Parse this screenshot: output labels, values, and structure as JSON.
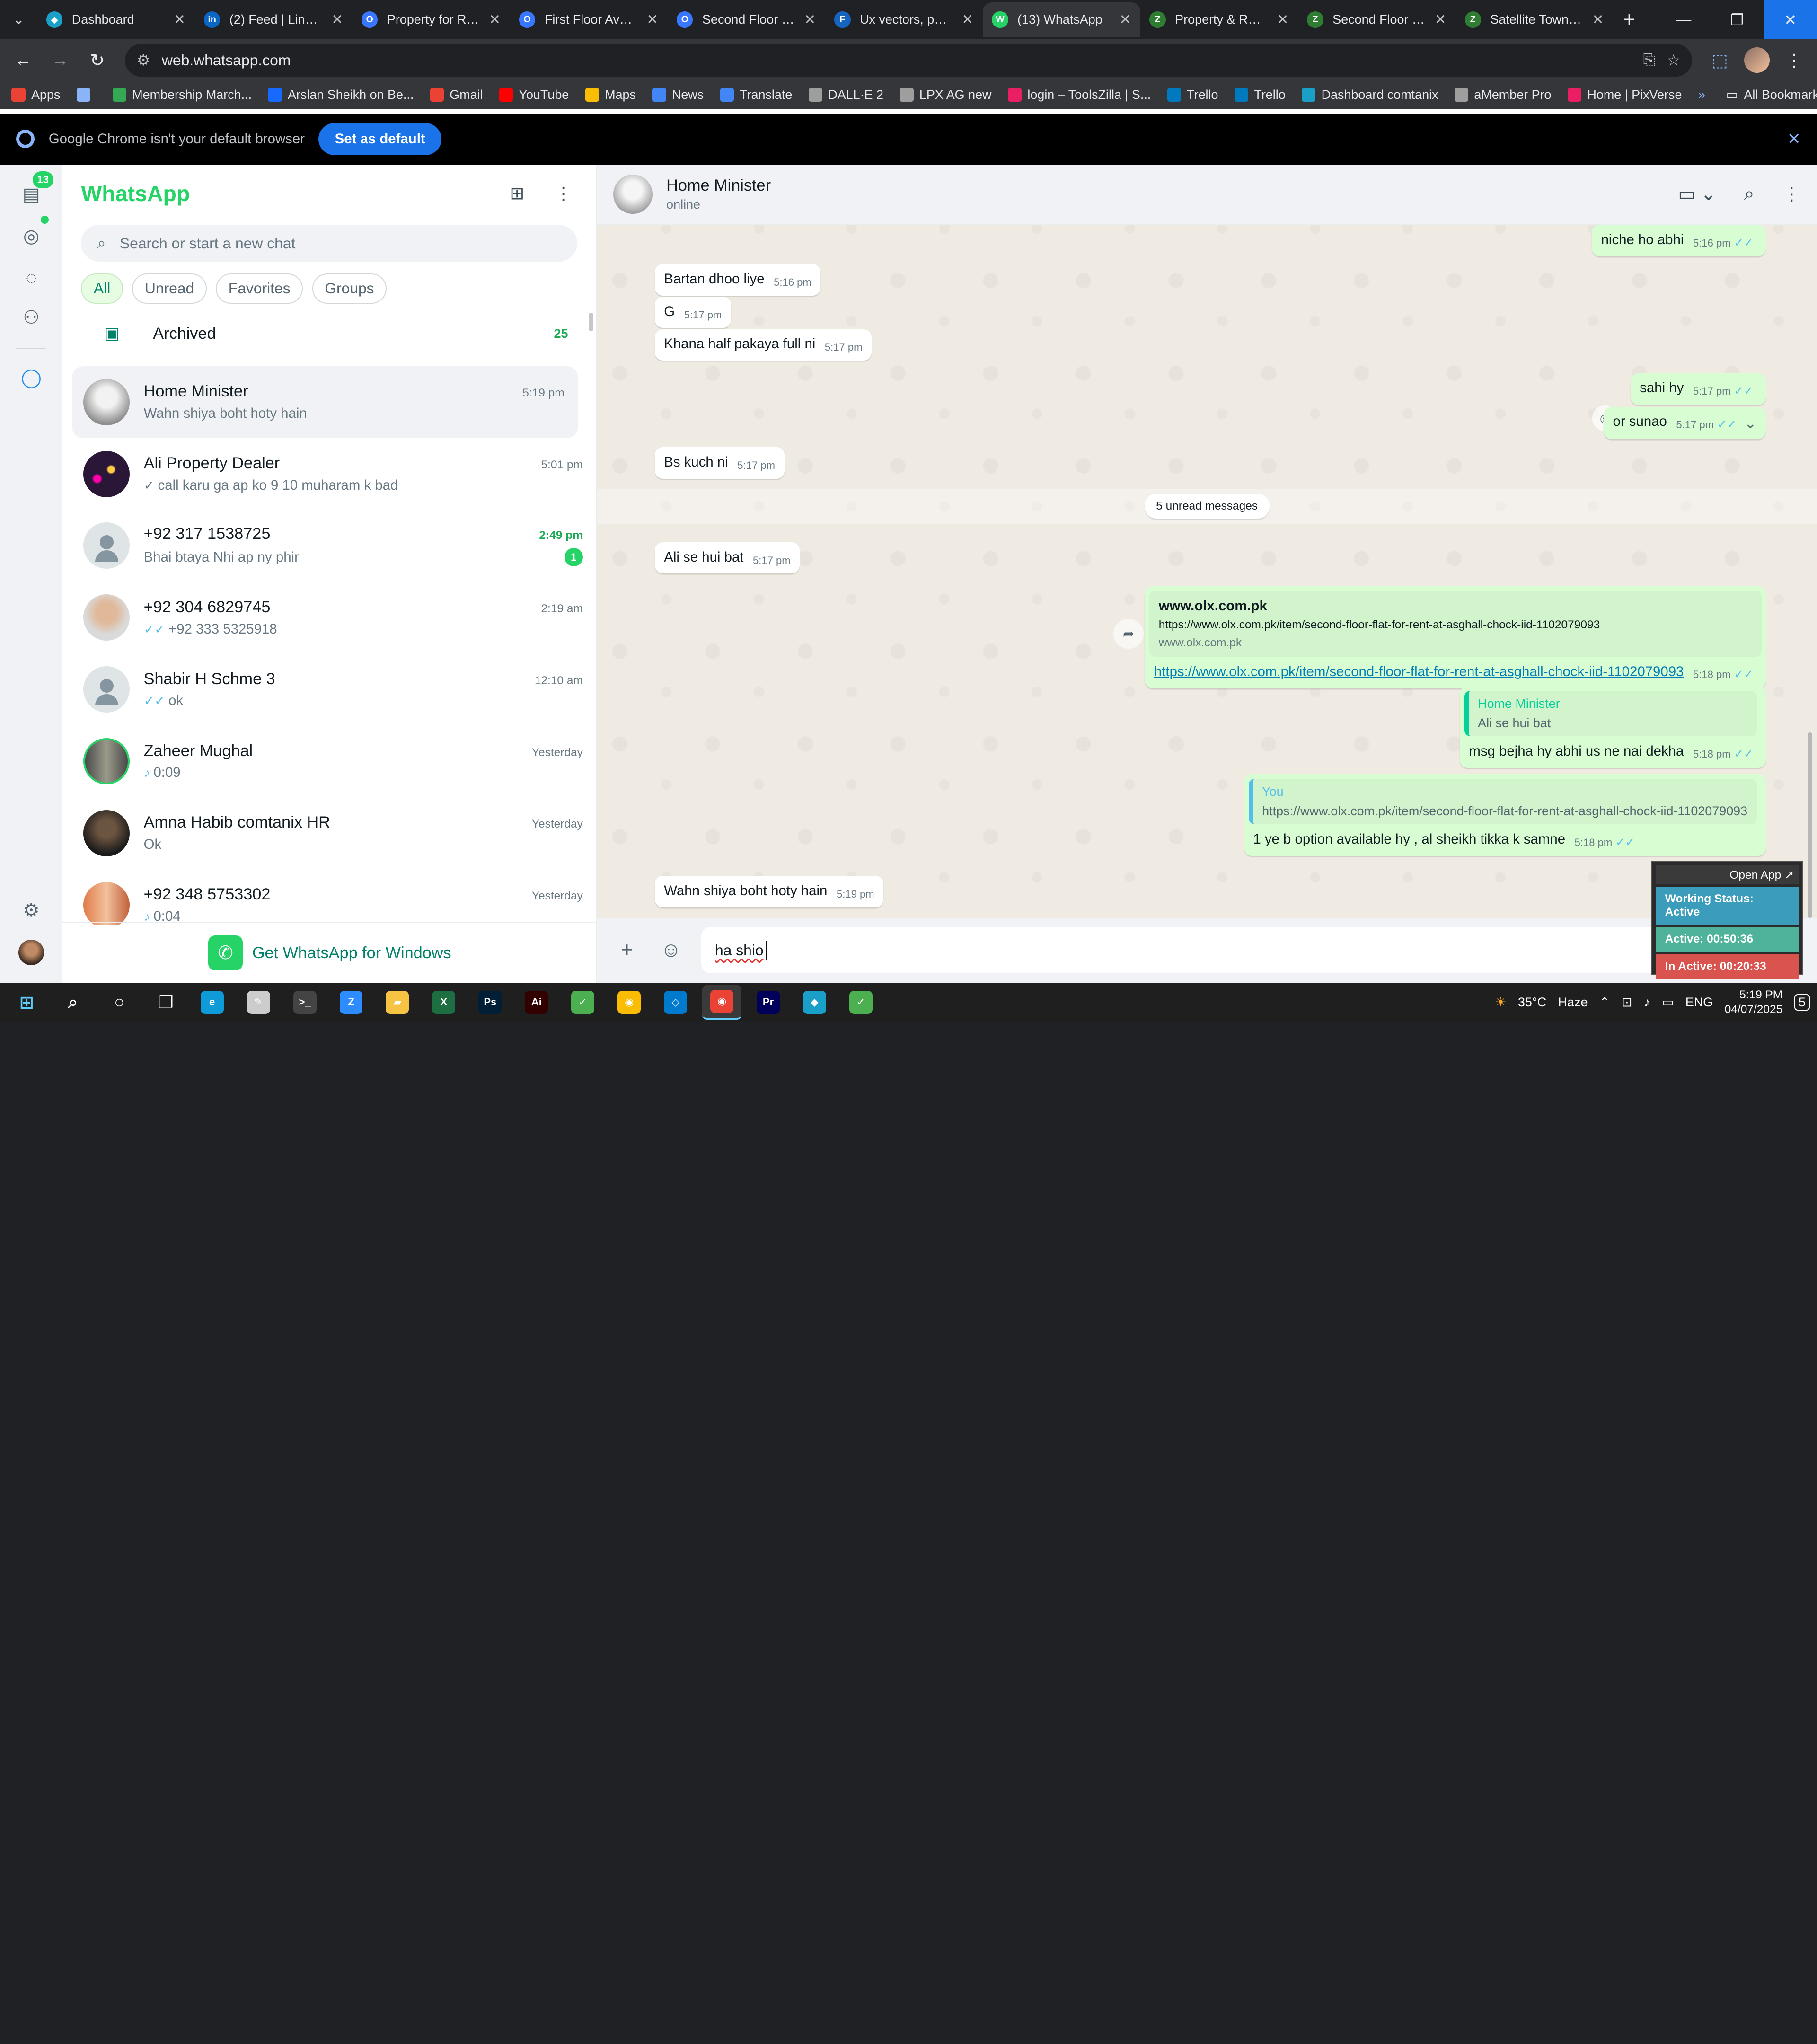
{
  "browser": {
    "tabs": [
      {
        "title": "Dashboard",
        "color": "#1aa0c8",
        "glyph": "◆"
      },
      {
        "title": "(2) Feed | LinkedIn",
        "color": "#0a66c2",
        "glyph": "in"
      },
      {
        "title": "Property for Rent",
        "color": "#3a77ff",
        "glyph": "O"
      },
      {
        "title": "First Floor Ava For",
        "color": "#3a77ff",
        "glyph": "O"
      },
      {
        "title": "Second Floor Flat",
        "color": "#3a77ff",
        "glyph": "O"
      },
      {
        "title": "Ux vectors, photos",
        "color": "#1565c0",
        "glyph": "F"
      },
      {
        "title": "(13) WhatsApp",
        "color": "#25d366",
        "glyph": "W"
      },
      {
        "title": "Property & Real E",
        "color": "#2e7d32",
        "glyph": "Z"
      },
      {
        "title": "Second Floor Flat",
        "color": "#2e7d32",
        "glyph": "Z"
      },
      {
        "title": "Satellite Town 5 M",
        "color": "#2e7d32",
        "glyph": "Z"
      }
    ],
    "active_tab_index": 6,
    "url": "web.whatsapp.com",
    "bookmarks": [
      {
        "label": "Apps",
        "color": "#ea4335"
      },
      {
        "label": "",
        "color": "#8ab4f8"
      },
      {
        "label": "Membership March...",
        "color": "#34a853"
      },
      {
        "label": "Arslan Sheikh on Be...",
        "color": "#1769ff"
      },
      {
        "label": "Gmail",
        "color": "#ea4335"
      },
      {
        "label": "YouTube",
        "color": "#ff0000"
      },
      {
        "label": "Maps",
        "color": "#fbbc04"
      },
      {
        "label": "News",
        "color": "#4285f4"
      },
      {
        "label": "Translate",
        "color": "#4285f4"
      },
      {
        "label": "DALL·E 2",
        "color": "#9e9e9e"
      },
      {
        "label": "LPX AG new",
        "color": "#9e9e9e"
      },
      {
        "label": "login – ToolsZilla | S...",
        "color": "#e91e63"
      },
      {
        "label": "Trello",
        "color": "#0079bf"
      },
      {
        "label": "Trello",
        "color": "#0079bf"
      },
      {
        "label": "Dashboard comtanix",
        "color": "#1aa0c8"
      },
      {
        "label": "aMember Pro",
        "color": "#9e9e9e"
      },
      {
        "label": "Home | PixVerse",
        "color": "#e91e63"
      }
    ],
    "all_bookmarks": "All Bookmarks",
    "infobar_text": "Google Chrome isn't your default browser",
    "infobar_button": "Set as default"
  },
  "rail": {
    "badge": "13"
  },
  "sidebar": {
    "title": "WhatsApp",
    "search_placeholder": "Search or start a new chat",
    "filters": [
      "All",
      "Unread",
      "Favorites",
      "Groups"
    ],
    "archived_label": "Archived",
    "archived_count": "25",
    "get_app": "Get WhatsApp for Windows",
    "chats": [
      {
        "name": "Home Minister",
        "time": "5:19 pm",
        "preview": "Wahn shiya boht hoty hain",
        "avatar": "photo-grey",
        "tick": "",
        "unread": "",
        "active": true
      },
      {
        "name": "Ali Property Dealer",
        "time": "5:01 pm",
        "preview": "call karu ga ap ko 9 10 muharam k bad",
        "avatar": "photo-candles",
        "tick": "grey",
        "unread": "",
        "active": false
      },
      {
        "name": "+92 317 1538725",
        "time": "2:49 pm",
        "preview": "Bhai btaya Nhi ap ny phir",
        "avatar": "default",
        "tick": "",
        "unread": "1",
        "active": false
      },
      {
        "name": "+92 304 6829745",
        "time": "2:19 am",
        "preview": "+92 333 5325918",
        "avatar": "photo-man",
        "tick": "blue",
        "unread": "",
        "active": false
      },
      {
        "name": "Shabir H  Schme 3",
        "time": "12:10 am",
        "preview": "ok",
        "avatar": "default",
        "tick": "blue",
        "unread": "",
        "active": false
      },
      {
        "name": "Zaheer Mughal",
        "time": "Yesterday",
        "preview": "0:09",
        "avatar": "photo-group",
        "tick": "mic",
        "unread": "",
        "active": false
      },
      {
        "name": "Amna Habib comtanix HR",
        "time": "Yesterday",
        "preview": "Ok",
        "avatar": "photo-dark",
        "tick": "",
        "unread": "",
        "active": false
      },
      {
        "name": "+92 348 5753302",
        "time": "Yesterday",
        "preview": "0:04",
        "avatar": "photo-couple",
        "tick": "mic",
        "unread": "",
        "active": false
      }
    ]
  },
  "conversation": {
    "name": "Home Minister",
    "status": "online",
    "unread_divider": "5 unread messages",
    "composer_text": "ha shio",
    "messages": [
      {
        "dir": "out",
        "text": "niche ho abhi",
        "time": "5:16 pm",
        "tick": "blue"
      },
      {
        "dir": "in",
        "text": "Bartan dhoo liye",
        "time": "5:16 pm"
      },
      {
        "dir": "in",
        "text": "G",
        "time": "5:17 pm"
      },
      {
        "dir": "in",
        "text": "Khana half pakaya full ni",
        "time": "5:17 pm"
      },
      {
        "dir": "out",
        "text": "sahi hy",
        "time": "5:17 pm",
        "tick": "blue"
      },
      {
        "dir": "out",
        "text": "or sunao",
        "time": "5:17 pm",
        "tick": "blue"
      },
      {
        "dir": "in",
        "text": "Bs kuch ni",
        "time": "5:17 pm"
      },
      {
        "dir": "in",
        "text": "Ali se hui bat",
        "time": "5:17 pm"
      },
      {
        "dir": "out",
        "kind": "link",
        "link_title": "www.olx.com.pk",
        "link_sub": "https://www.olx.com.pk/item/second-floor-flat-for-rent-at-asghall-chock-iid-1102079093",
        "link_domain": "www.olx.com.pk",
        "text": "https://www.olx.com.pk/item/second-floor-flat-for-rent-at-asghall-chock-iid-1102079093",
        "time": "5:18 pm",
        "tick": "blue"
      },
      {
        "dir": "out",
        "kind": "reply",
        "quote_name": "Home Minister",
        "quote_text": "Ali se hui bat",
        "text": "msg bejha hy abhi us ne nai dekha",
        "time": "5:18 pm",
        "tick": "blue"
      },
      {
        "dir": "out",
        "kind": "reply",
        "quote_name": "You",
        "quote_text": "https://www.olx.com.pk/item/second-floor-flat-for-rent-at-asghall-chock-iid-1102079093",
        "text": "1 ye b option available hy , al sheikh tikka k samne",
        "time": "5:18 pm",
        "tick": "blue"
      },
      {
        "dir": "in",
        "text": "Wahn shiya boht hoty hain",
        "time": "5:19 pm"
      }
    ]
  },
  "tracker": {
    "open_app": "Open App ↗",
    "working_status": "Working Status: Active",
    "active": "Active: 00:50:36",
    "inactive": "In Active: 00:20:33"
  },
  "taskbar": {
    "apps": [
      {
        "name": "windows-start",
        "color": "#60cdff",
        "glyph": "⊞"
      },
      {
        "name": "search",
        "color": "#ffffff",
        "glyph": "⌕"
      },
      {
        "name": "cortana",
        "color": "#ffffff",
        "glyph": "○"
      },
      {
        "name": "task-view",
        "color": "#ffffff",
        "glyph": "❐"
      },
      {
        "name": "edge",
        "color": "#0f9bd7",
        "glyph": "e"
      },
      {
        "name": "pen",
        "color": "#cccccc",
        "glyph": "✎"
      },
      {
        "name": "terminal",
        "color": "#444444",
        "glyph": ">_"
      },
      {
        "name": "zoom",
        "color": "#2d8cff",
        "glyph": "Z"
      },
      {
        "name": "explorer",
        "color": "#f6c343",
        "glyph": "▰"
      },
      {
        "name": "excel",
        "color": "#1d6f42",
        "glyph": "X"
      },
      {
        "name": "photoshop",
        "color": "#001e36",
        "glyph": "Ps"
      },
      {
        "name": "illustrator",
        "color": "#330000",
        "glyph": "Ai"
      },
      {
        "name": "app-green",
        "color": "#4caf50",
        "glyph": "✓"
      },
      {
        "name": "chrome",
        "color": "#fbbc04",
        "glyph": "◉"
      },
      {
        "name": "vscode",
        "color": "#007acc",
        "glyph": "◇"
      },
      {
        "name": "chrome-active",
        "color": "#ea4335",
        "glyph": "◉"
      },
      {
        "name": "premiere",
        "color": "#00005b",
        "glyph": "Pr"
      },
      {
        "name": "app-blue",
        "color": "#1aa0c8",
        "glyph": "◆"
      },
      {
        "name": "app-green-2",
        "color": "#4caf50",
        "glyph": "✓"
      }
    ],
    "weather_temp": "35°C",
    "weather_text": "Haze",
    "lang": "ENG",
    "time": "5:19 PM",
    "date": "04/07/2025",
    "notif": "5"
  }
}
